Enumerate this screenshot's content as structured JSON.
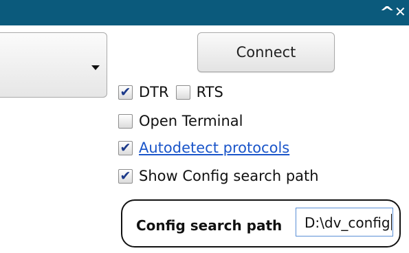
{
  "window": {
    "titlebar_color": "#0b5a7c",
    "controls": [
      "collapse-icon",
      "close-icon"
    ]
  },
  "port_select": {
    "selected_value": "",
    "icon": "chevron-down-icon"
  },
  "connect_button": {
    "label": "Connect"
  },
  "options": {
    "dtr": {
      "label": "DTR",
      "checked": true
    },
    "rts": {
      "label": "RTS",
      "checked": false
    },
    "open_terminal": {
      "label": "Open Terminal",
      "checked": false
    },
    "autodetect": {
      "label": "Autodetect protocols",
      "checked": true
    },
    "show_config": {
      "label": "Show Config search path",
      "checked": true
    }
  },
  "config_path": {
    "label": "Config search path",
    "value": "D:\\dv_config"
  }
}
